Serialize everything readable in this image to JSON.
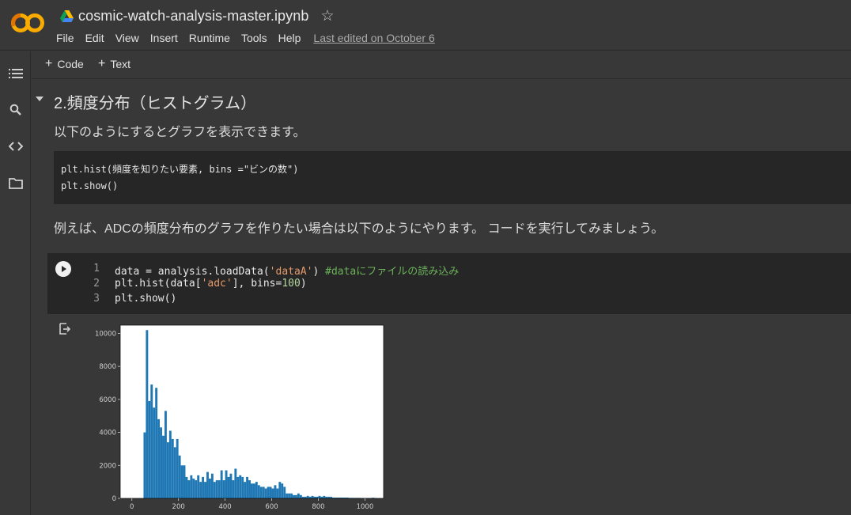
{
  "header": {
    "notebook_title": "cosmic-watch-analysis-master.ipynb",
    "star_icon": "star-outline-icon",
    "menu": [
      "File",
      "Edit",
      "View",
      "Insert",
      "Runtime",
      "Tools",
      "Help"
    ],
    "last_edited": "Last edited on October 6",
    "colors": {
      "logo_orange": "#f9ab00",
      "logo_dark_orange": "#e37400"
    }
  },
  "rail": {
    "icons": [
      "table-of-contents-icon",
      "search-icon",
      "code-snippets-icon",
      "files-icon"
    ]
  },
  "toolbar": {
    "code_label": "Code",
    "text_label": "Text"
  },
  "content": {
    "section_heading": "2.頻度分布（ヒストグラム）",
    "intro_text": "以下のようにするとグラフを表示できます。",
    "md_code_lines": [
      "plt.hist(頻度を知りたい要素, bins =\"ビンの数\")",
      "plt.show()"
    ],
    "example_text": "例えば、ADCの頻度分布のグラフを作りたい場合は以下のようにやります。 コードを実行してみましょう。"
  },
  "code_cell": {
    "line_numbers": [
      "1",
      "2",
      "3"
    ],
    "line1": {
      "a": "data = analysis.loadData(",
      "str": "'dataA'",
      "b": ") ",
      "comment": "#dataにファイルの読み込み"
    },
    "line2": {
      "a": "plt.hist(data[",
      "str": "'adc'",
      "b": "], bins=",
      "num": "100",
      "c": ")"
    },
    "line3": {
      "a": "plt.show()"
    }
  },
  "chart_data": {
    "type": "bar",
    "title": "",
    "xlabel": "",
    "ylabel": "",
    "xlim": [
      -50,
      1080
    ],
    "ylim": [
      0,
      10500
    ],
    "xticks": [
      0,
      200,
      400,
      600,
      800,
      1000
    ],
    "yticks": [
      0,
      2000,
      4000,
      6000,
      8000,
      10000
    ],
    "bar_color": "#1f77b4",
    "bin_width": 9.8,
    "x": [
      50,
      60,
      70,
      80,
      90,
      100,
      110,
      120,
      130,
      140,
      150,
      160,
      170,
      180,
      190,
      200,
      210,
      220,
      230,
      240,
      250,
      260,
      270,
      280,
      290,
      300,
      310,
      320,
      330,
      340,
      350,
      360,
      370,
      380,
      390,
      400,
      410,
      420,
      430,
      440,
      450,
      460,
      470,
      480,
      490,
      500,
      510,
      520,
      530,
      540,
      550,
      560,
      570,
      580,
      590,
      600,
      610,
      620,
      630,
      640,
      650,
      660,
      670,
      680,
      690,
      700,
      710,
      720,
      730,
      740,
      750,
      760,
      770,
      780,
      790,
      800,
      810,
      820,
      830,
      840,
      850,
      860,
      870,
      880,
      890,
      900,
      910,
      920,
      930,
      940,
      950,
      960,
      970,
      980,
      990,
      1000,
      1010,
      1020,
      1030,
      1040
    ],
    "values": [
      4000,
      10200,
      5900,
      6900,
      5500,
      6700,
      4800,
      4300,
      3800,
      5300,
      3400,
      4100,
      3600,
      3100,
      3600,
      2600,
      2000,
      2000,
      1300,
      1100,
      1400,
      1200,
      1100,
      1400,
      1000,
      1300,
      1000,
      1600,
      1200,
      1500,
      1000,
      1100,
      1100,
      1700,
      1100,
      1700,
      1300,
      1500,
      1100,
      1800,
      1300,
      1400,
      1300,
      1000,
      1300,
      1100,
      900,
      900,
      1000,
      800,
      700,
      700,
      600,
      700,
      700,
      600,
      800,
      600,
      1000,
      900,
      700,
      300,
      300,
      300,
      200,
      200,
      300,
      200,
      100,
      100,
      150,
      100,
      150,
      100,
      100,
      150,
      100,
      150,
      100,
      100,
      100,
      50,
      50,
      50,
      50,
      50,
      50,
      50,
      30,
      30,
      30,
      30,
      30,
      20,
      20,
      20,
      20,
      20,
      40,
      20
    ]
  }
}
